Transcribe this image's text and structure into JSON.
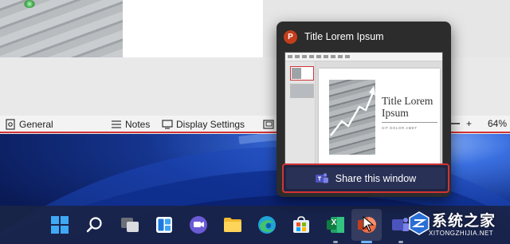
{
  "powerpoint": {
    "statusbar": {
      "general_label": "General",
      "notes_label": "Notes",
      "display_settings_label": "Display Settings",
      "zoom_minus": "−",
      "zoom_plus": "+",
      "zoom_level": "64%"
    }
  },
  "thumbnail_popup": {
    "app_icon_letter": "P",
    "window_title": "Title Lorem Ipsum",
    "preview": {
      "slide_title": "Title Lorem Ipsum",
      "slide_subtitle": "SIT DOLOR AMET"
    },
    "share_button_label": "Share this window"
  },
  "taskbar": {
    "items": [
      {
        "name": "start",
        "icon": "windows-logo-icon"
      },
      {
        "name": "search",
        "icon": "search-icon"
      },
      {
        "name": "task-view",
        "icon": "task-view-icon"
      },
      {
        "name": "widgets",
        "icon": "widgets-icon"
      },
      {
        "name": "teams-chat",
        "icon": "chat-icon"
      },
      {
        "name": "file-explorer",
        "icon": "folder-icon"
      },
      {
        "name": "edge",
        "icon": "edge-icon"
      },
      {
        "name": "store",
        "icon": "store-icon"
      },
      {
        "name": "excel",
        "icon": "excel-icon"
      },
      {
        "name": "powerpoint",
        "icon": "powerpoint-icon"
      },
      {
        "name": "teams",
        "icon": "teams-icon"
      }
    ],
    "excel_letter": "X",
    "powerpoint_letter": "P"
  },
  "watermark": {
    "text": "系统之家",
    "subtext": "XITONGZHIJIA.NET"
  },
  "colors": {
    "accent_red": "#d13438",
    "powerpoint_orange": "#c43e1c",
    "taskbar_bg": "#1a2448",
    "popup_bg": "#2c2c2c"
  }
}
